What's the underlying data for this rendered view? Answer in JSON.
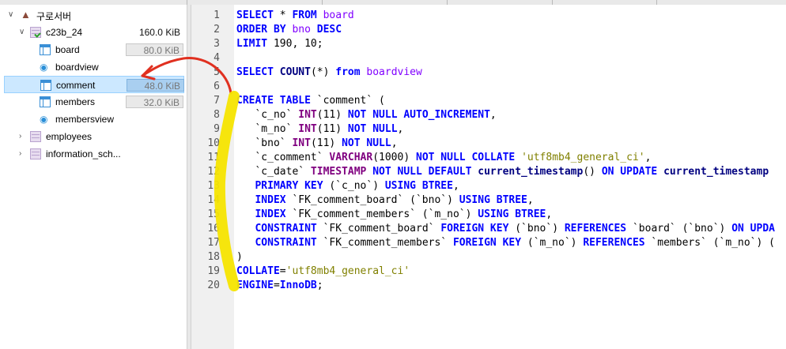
{
  "tree": {
    "server": {
      "label": "구로서버"
    },
    "database": {
      "label": "c23b_24",
      "size": "160.0 KiB"
    },
    "items": [
      {
        "label": "board",
        "size": "80.0 KiB",
        "kind": "table"
      },
      {
        "label": "boardview",
        "size": "",
        "kind": "view"
      },
      {
        "label": "comment",
        "size": "48.0 KiB",
        "kind": "table",
        "selected": true
      },
      {
        "label": "members",
        "size": "32.0 KiB",
        "kind": "table"
      },
      {
        "label": "membersview",
        "size": "",
        "kind": "view"
      }
    ],
    "other_databases": [
      {
        "label": "employees"
      },
      {
        "label": "information_sch..."
      }
    ]
  },
  "editor": {
    "line_numbers": [
      "1",
      "2",
      "3",
      "4",
      "5",
      "6",
      "7",
      "8",
      "9",
      "10",
      "11",
      "12",
      "13",
      "14",
      "15",
      "16",
      "17",
      "18",
      "19",
      "20"
    ]
  },
  "colors": {
    "selection": "#cce8ff",
    "keyword": "#0000ff",
    "annotation_arrow": "#e03020",
    "annotation_highlight": "#f5e400"
  },
  "icons": [
    "server-icon",
    "database-icon",
    "table-icon",
    "view-icon",
    "chevron-icon"
  ]
}
